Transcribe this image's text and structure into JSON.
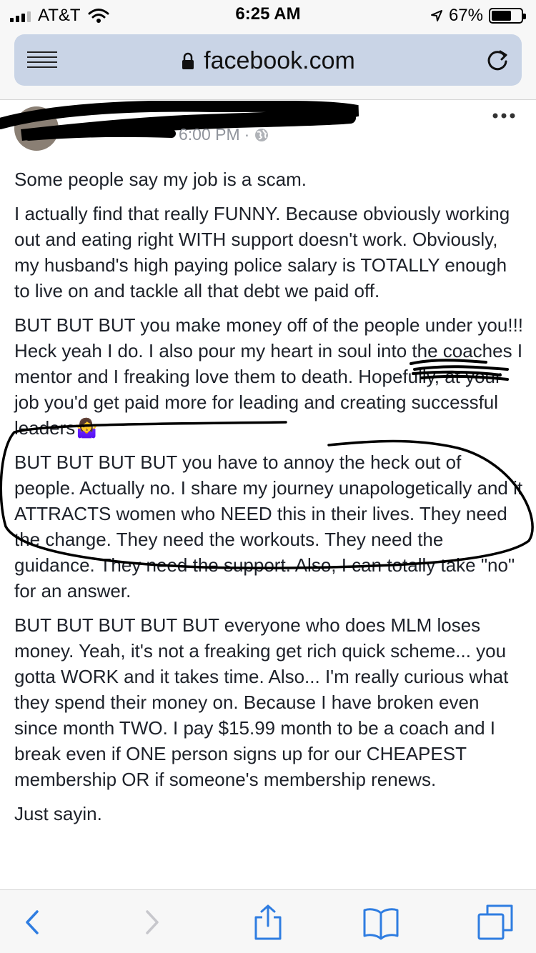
{
  "status_bar": {
    "carrier": "AT&T",
    "time": "6:25 AM",
    "battery_percent": "67%",
    "battery_level": 0.67,
    "icons": [
      "signal-icon",
      "wifi-icon",
      "location-arrow-icon",
      "battery-icon"
    ]
  },
  "browser": {
    "url": "facebook.com",
    "icons": [
      "menu-icon",
      "lock-icon",
      "reload-icon"
    ]
  },
  "post": {
    "timestamp": "6:00 PM",
    "meta_separator": "·",
    "more_label": "•••",
    "paragraphs": [
      "Some people say my job is a scam.",
      "I actually find that really FUNNY. Because obviously working out and eating right WITH support doesn't work. Obviously, my husband's high paying police salary is TOTALLY enough to live on and tackle all that debt we paid off.",
      "BUT BUT BUT you make money off of the people under you!!! Heck yeah I do. I also pour my heart in soul into the coaches I mentor and I freaking love them to death. Hopefully, at your job you'd get paid more for leading and creating successful leaders🤷‍♀️",
      "BUT BUT BUT BUT you have to annoy the heck out of people. Actually no. I share my journey unapologetically and it ATTRACTS women who NEED this in their lives. They need the change. They need the workouts. They need the guidance. They need the support. Also, I can totally take \"no\" for an answer.",
      "BUT BUT BUT BUT BUT everyone who does MLM loses money. Yeah, it's not a freaking get rich quick scheme... you gotta WORK and it takes time. Also... I'm really curious what they spend their money on. Because I have broken even since month TWO. I pay $15.99 month to be a coach and I break even if ONE person signs up for our CHEAPEST membership OR if someone's membership renews.",
      "Just sayin."
    ]
  },
  "toolbar": {
    "icons": [
      "back-icon",
      "forward-icon",
      "share-icon",
      "bookmarks-icon",
      "tabs-icon"
    ]
  },
  "colors": {
    "address_bar": "#c9d4e6",
    "toolbar_icon": "#2f7de1",
    "toolbar_icon_disabled": "#c7c7cc",
    "meta_text": "#90949c"
  }
}
